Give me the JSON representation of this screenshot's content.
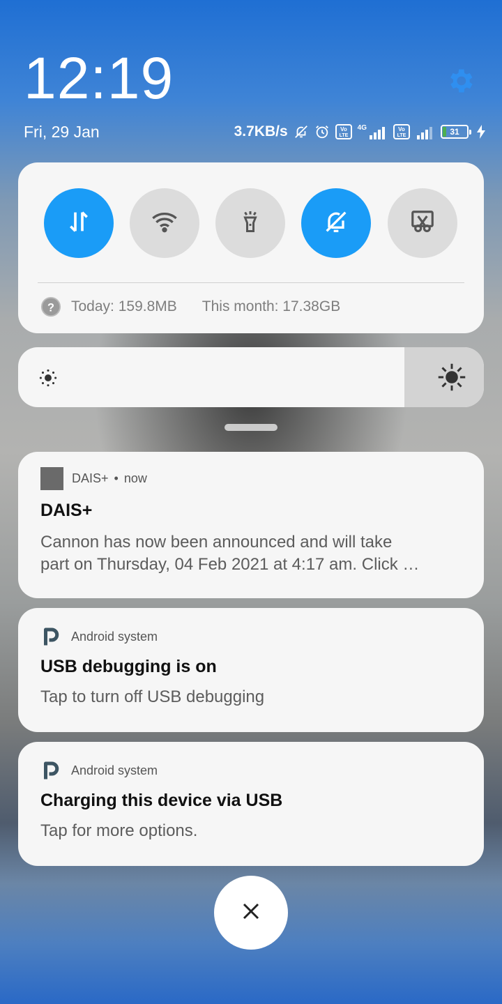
{
  "status": {
    "time": "12:19",
    "date": "Fri, 29 Jan",
    "net_speed": "3.7KB/s",
    "net_type_1": "4G",
    "volte_1": "Vo LTE",
    "volte_2": "Vo LTE",
    "battery_level": "31"
  },
  "quick_settings": {
    "toggles": [
      {
        "name": "mobile-data",
        "icon": "data-arrows-icon",
        "on": true
      },
      {
        "name": "wifi",
        "icon": "wifi-icon",
        "on": false
      },
      {
        "name": "flashlight",
        "icon": "flashlight-icon",
        "on": false
      },
      {
        "name": "silent",
        "icon": "bell-off-icon",
        "on": true
      },
      {
        "name": "screenshot",
        "icon": "scissors-icon",
        "on": false
      }
    ],
    "usage_today": "Today: 159.8MB",
    "usage_month": "This month: 17.38GB"
  },
  "brightness": {
    "level": 0.83
  },
  "notifications": [
    {
      "app": "DAIS+",
      "time": "now",
      "separator": "•",
      "title": "DAIS+",
      "body_line1": "Cannon has now been announced and will take",
      "body_line2": "part on Thursday, 04 Feb 2021 at 4:17 am. Click …"
    },
    {
      "app": "Android system",
      "title": "USB debugging is on",
      "body": "Tap to turn off USB debugging"
    },
    {
      "app": "Android system",
      "title": "Charging this device via USB",
      "body": "Tap for more options."
    }
  ],
  "colors": {
    "accent": "#1a9cf7",
    "card": "#f6f6f6",
    "toggle_off": "#dcdcdc"
  }
}
